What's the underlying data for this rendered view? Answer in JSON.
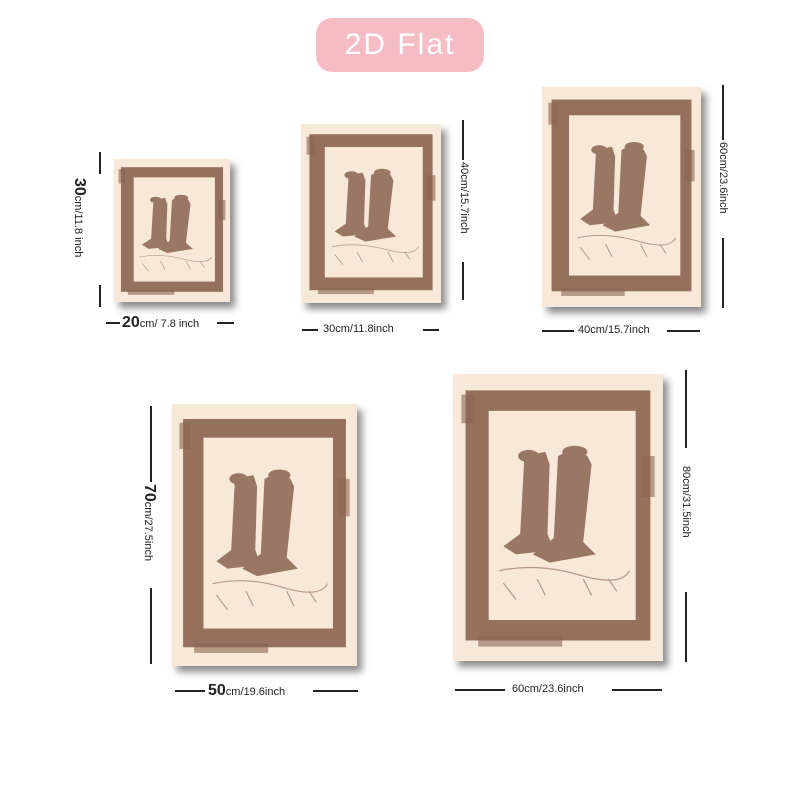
{
  "header": {
    "badge_label": "2D Flat"
  },
  "accent_colors": {
    "badge": "#f6bcc4",
    "paper": "#f7e8d8",
    "ink": "#8a6450"
  },
  "artwork": {
    "subject": "cowboy-boots-icon"
  },
  "sizes": [
    {
      "width_cm": "20",
      "width_rest": "cm/ 7.8 inch",
      "height_cm": "30",
      "height_rest": "cm/11.8 inch"
    },
    {
      "width_cm": "30",
      "width_rest": "cm/11.8inch",
      "height_cm": "40",
      "height_rest": "cm/15.7inch"
    },
    {
      "width_cm": "40",
      "width_rest": "cm/15.7inch",
      "height_cm": "60",
      "height_rest": "cm/23.6inch"
    },
    {
      "width_cm": "50",
      "width_rest": "cm/19.6inch",
      "height_cm": "70",
      "height_rest": "cm/27.5inch"
    },
    {
      "width_cm": "60",
      "width_rest": "cm/23.6inch",
      "height_cm": "80",
      "height_rest": "cm/31.5inch"
    }
  ]
}
